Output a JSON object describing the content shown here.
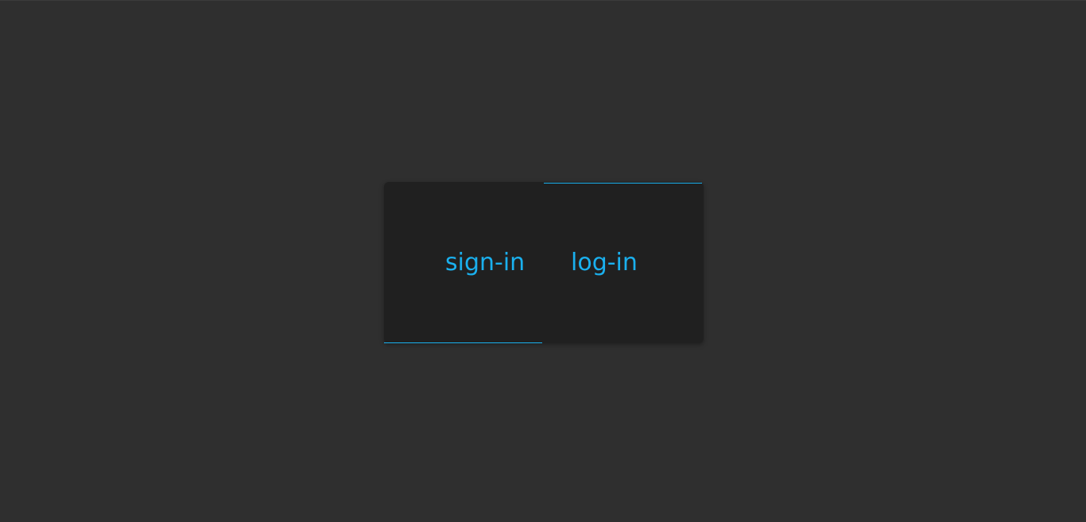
{
  "card": {
    "signin_label": "sign-in",
    "login_label": "log-in"
  },
  "colors": {
    "background": "#2f2f2f",
    "card": "#202020",
    "accent": "#1ab0ee"
  }
}
